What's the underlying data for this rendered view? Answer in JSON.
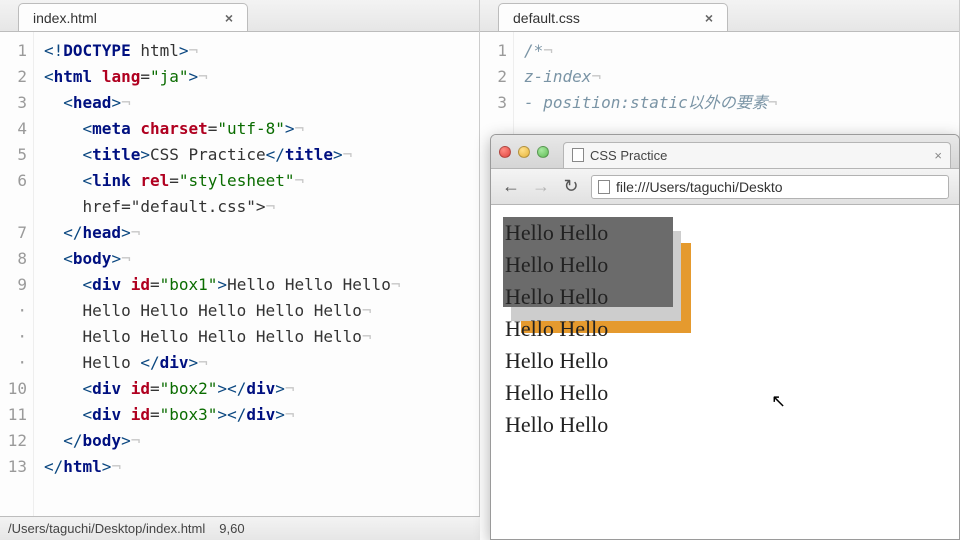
{
  "left_editor": {
    "tab_title": "index.html",
    "gutter": [
      "1",
      "2",
      "3",
      "4",
      "5",
      "6",
      "",
      "7",
      "8",
      "9",
      "·",
      "·",
      "·",
      "10",
      "11",
      "12",
      "13"
    ],
    "lines_plain": [
      "<!DOCTYPE html>",
      "<html lang=\"ja\">",
      "  <head>",
      "    <meta charset=\"utf-8\">",
      "    <title>CSS Practice</title>",
      "    <link rel=\"stylesheet\"",
      "    href=\"default.css\">",
      "  </head>",
      "  <body>",
      "    <div id=\"box1\">Hello Hello Hello",
      "    Hello Hello Hello Hello Hello",
      "    Hello Hello Hello Hello Hello",
      "    Hello </div>",
      "    <div id=\"box2\"></div>",
      "    <div id=\"box3\"></div>",
      "  </body>",
      "</html>"
    ]
  },
  "right_editor": {
    "tab_title": "default.css",
    "gutter": [
      "1",
      "2",
      "3"
    ],
    "lines": [
      "/*",
      "z-index",
      "- position:static以外の要素"
    ]
  },
  "statusbar": {
    "path": "/Users/taguchi/Desktop/index.html",
    "position": "9,60"
  },
  "browser": {
    "tab_title": "CSS Practice",
    "url": "file:///Users/taguchi/Deskto",
    "nav": {
      "back": "←",
      "forward": "→",
      "reload": "↻"
    },
    "page_lines": [
      "Hello Hello",
      "Hello Hello",
      "Hello Hello",
      "Hello Hello",
      "Hello Hello",
      "Hello Hello",
      "Hello Hello"
    ]
  },
  "colors": {
    "box1": "#6b6b6b",
    "box2": "#cdcdcd",
    "box3": "#e59a2e"
  },
  "cursor": "↖"
}
